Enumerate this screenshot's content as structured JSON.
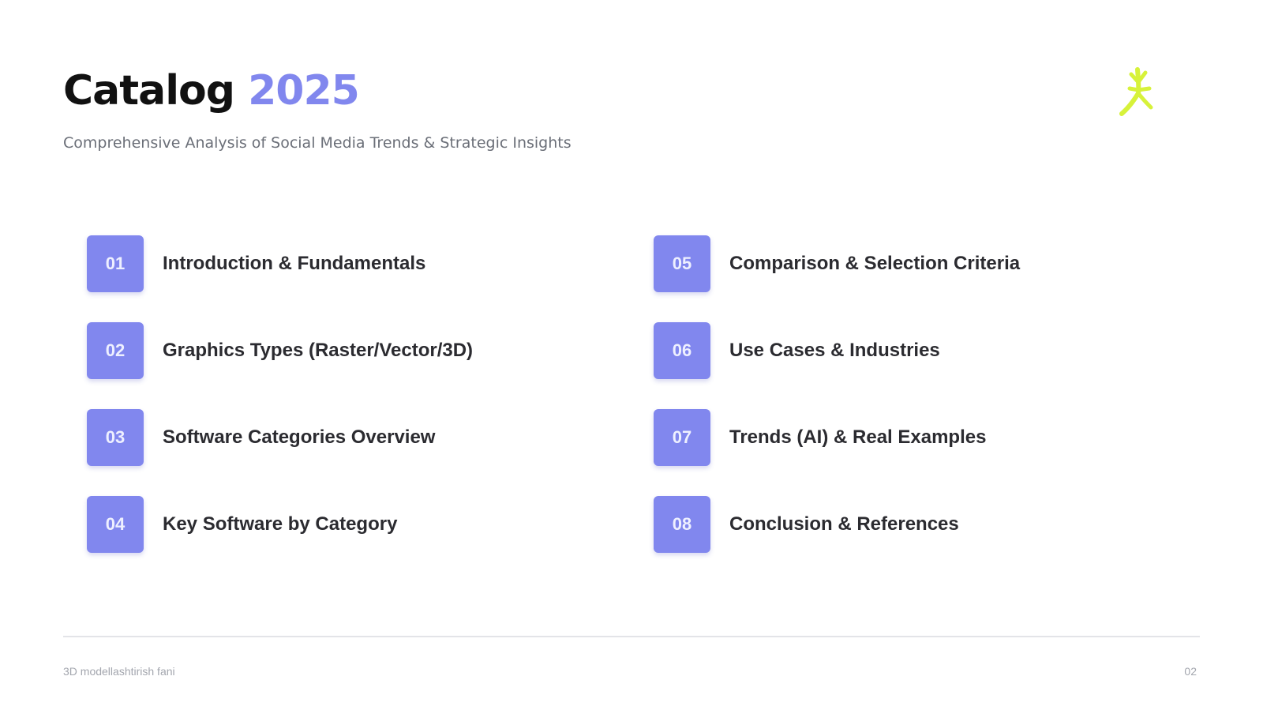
{
  "header": {
    "title_main": "Catalog",
    "title_accent": "2025",
    "subtitle": "Comprehensive Analysis of Social Media Trends & Strategic Insights",
    "logo_icon": "spark-figure-icon"
  },
  "toc": {
    "left_column": [
      {
        "number": "01",
        "label": "Introduction & Fundamentals"
      },
      {
        "number": "02",
        "label": "Graphics Types (Raster/Vector/3D)"
      },
      {
        "number": "03",
        "label": "Software Categories Overview"
      },
      {
        "number": "04",
        "label": "Key Software by Category"
      }
    ],
    "right_column": [
      {
        "number": "05",
        "label": "Comparison & Selection Criteria"
      },
      {
        "number": "06",
        "label": "Use Cases & Industries"
      },
      {
        "number": "07",
        "label": "Trends (AI) & Real Examples"
      },
      {
        "number": "08",
        "label": "Conclusion & References"
      }
    ]
  },
  "footer": {
    "left_text": "3D modellashtirish fani",
    "page_number": "02"
  },
  "colors": {
    "accent": "#8187ee",
    "logo": "#d7f23a",
    "title": "#111111",
    "subtitle": "#6b6f78",
    "item_text": "#2b2b30",
    "footer_text": "#a3a6ae",
    "divider": "#e3e4e8"
  }
}
